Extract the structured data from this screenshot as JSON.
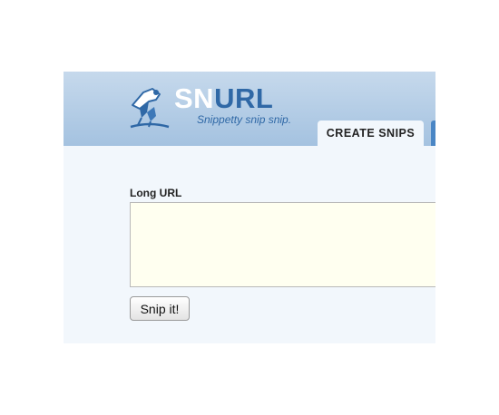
{
  "header": {
    "logo_sn": "SN",
    "logo_url": "URL",
    "tagline": "Snippetty snip snip."
  },
  "tabs": [
    {
      "label": "CREATE SNIPS",
      "active": true
    }
  ],
  "form": {
    "long_url_label": "Long URL",
    "long_url_value": "",
    "submit_label": "Snip it!"
  },
  "colors": {
    "header_top": "#c6d9ec",
    "header_bottom": "#a4c2e0",
    "brand_blue": "#2f68a6",
    "content_bg": "#f2f7fc",
    "input_bg": "#fffff0"
  }
}
